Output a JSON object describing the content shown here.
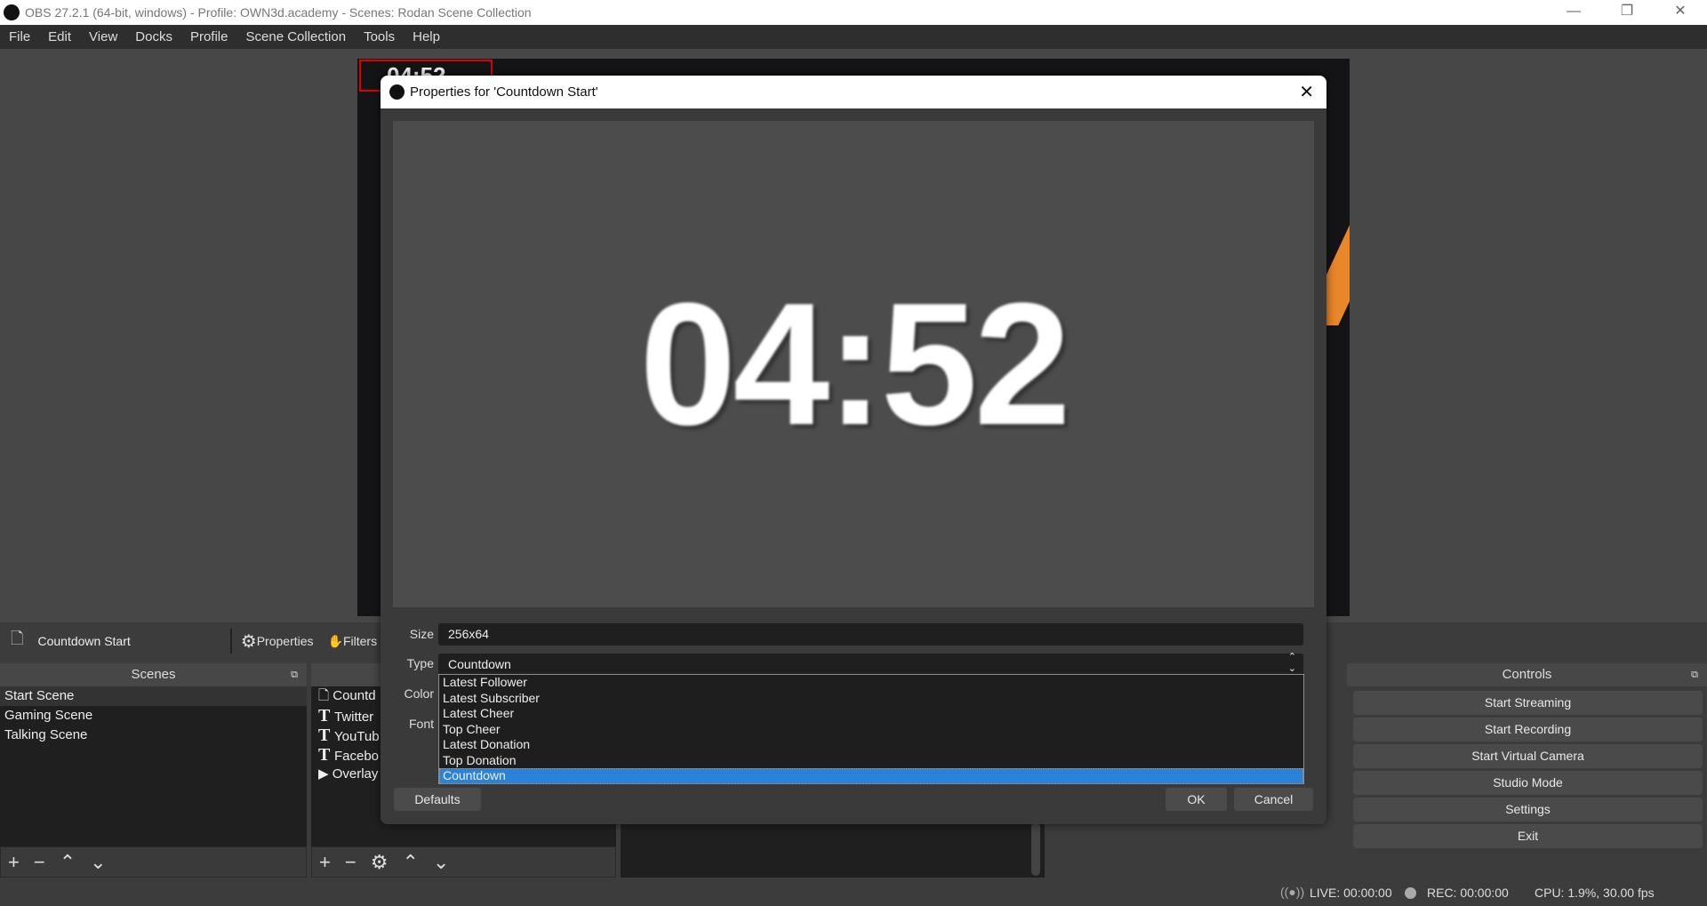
{
  "window": {
    "title": "OBS 27.2.1 (64-bit, windows) - Profile: OWN3d.academy - Scenes: Rodan Scene Collection",
    "controls": [
      "—",
      "❐",
      "✕"
    ]
  },
  "menu": [
    "File",
    "Edit",
    "View",
    "Docks",
    "Profile",
    "Scene Collection",
    "Tools",
    "Help"
  ],
  "canvas": {
    "mini_time": "04:52",
    "accent": "#e8862a"
  },
  "source_toolbar": {
    "selected_source": "Countdown Start",
    "properties": "Properties",
    "filters": "Filters"
  },
  "scenes": {
    "title": "Scenes",
    "items": [
      "Start Scene",
      "Gaming Scene",
      "Talking Scene"
    ],
    "selected": "Start Scene"
  },
  "sources": {
    "items": [
      {
        "icon": "file-icon",
        "label": "Countd"
      },
      {
        "icon": "text-icon",
        "label": "Twitter"
      },
      {
        "icon": "text-icon",
        "label": "YouTub"
      },
      {
        "icon": "text-icon",
        "label": "Facebo"
      },
      {
        "icon": "play-icon",
        "label": "Overlay"
      }
    ]
  },
  "controls": {
    "title": "Controls",
    "buttons": [
      "Start Streaming",
      "Start Recording",
      "Start Virtual Camera",
      "Studio Mode",
      "Settings",
      "Exit"
    ]
  },
  "status": {
    "live": "LIVE: 00:00:00",
    "rec": "REC: 00:00:00",
    "cpu": "CPU: 1.9%, 30.00 fps"
  },
  "dialog": {
    "title": "Properties for 'Countdown Start'",
    "preview_time": "04:52",
    "size_label": "Size",
    "size_value": "256x64",
    "type_label": "Type",
    "type_value": "Countdown",
    "color_label": "Color",
    "font_label": "Font",
    "type_options": [
      "Latest Follower",
      "Latest Subscriber",
      "Latest Cheer",
      "Top Cheer",
      "Latest Donation",
      "Top Donation",
      "Countdown"
    ],
    "selected_color": "#2b82da",
    "defaults": "Defaults",
    "ok": "OK",
    "cancel": "Cancel"
  }
}
